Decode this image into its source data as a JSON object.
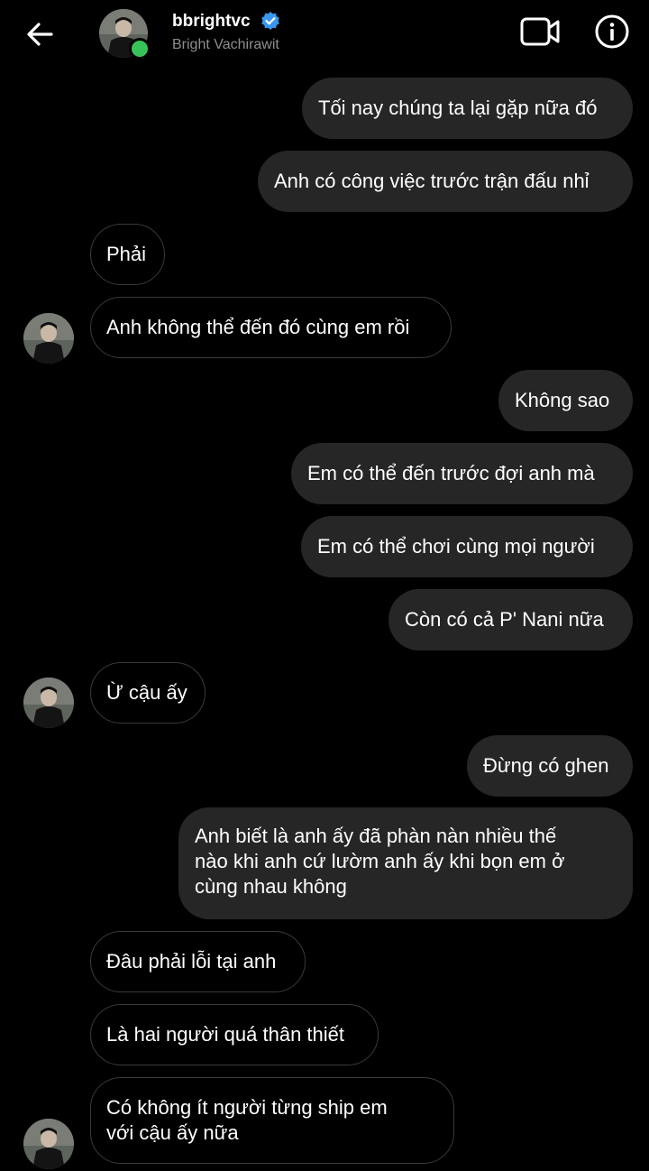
{
  "header": {
    "back_icon": "arrow-left-icon",
    "username": "bbrightvc",
    "full_name": "Bright Vachirawit",
    "verified_icon": "verified-badge-icon",
    "online_icon": "online-status-dot",
    "video_icon": "video-camera-icon",
    "info_icon": "info-icon",
    "accent_online": "#37c35a",
    "accent_verified": "#3897f0"
  },
  "messages": [
    {
      "side": "out",
      "text": "Tối nay chúng ta lại gặp nữa đó"
    },
    {
      "side": "out",
      "text": "Anh có công việc trước trận đấu nhỉ"
    },
    {
      "side": "in",
      "text": "Phải"
    },
    {
      "side": "in",
      "text": "Anh không thể đến đó cùng em rồi"
    },
    {
      "side": "out",
      "text": "Không sao"
    },
    {
      "side": "out",
      "text": "Em có thể đến trước đợi anh mà"
    },
    {
      "side": "out",
      "text": "Em có thể chơi cùng mọi người"
    },
    {
      "side": "out",
      "text": "Còn có cả P' Nani nữa"
    },
    {
      "side": "in",
      "text": "Ừ cậu ấy"
    },
    {
      "side": "out",
      "text": "Đừng có ghen"
    },
    {
      "side": "out",
      "text": "Anh biết là anh ấy đã phàn nàn nhiều thế\nnào khi anh cứ lườm anh ấy khi bọn em ở\ncùng nhau không"
    },
    {
      "side": "in",
      "text": "Đâu phải lỗi tại anh"
    },
    {
      "side": "in",
      "text": "Là hai người quá thân thiết"
    },
    {
      "side": "in",
      "text": "Có không ít người từng ship em\nvới cậu ấy nữa"
    }
  ],
  "colors": {
    "background": "#000000",
    "outgoing_bubble": "#262626",
    "incoming_border": "#3a3a3a",
    "secondary_text": "#8e8e8e"
  }
}
